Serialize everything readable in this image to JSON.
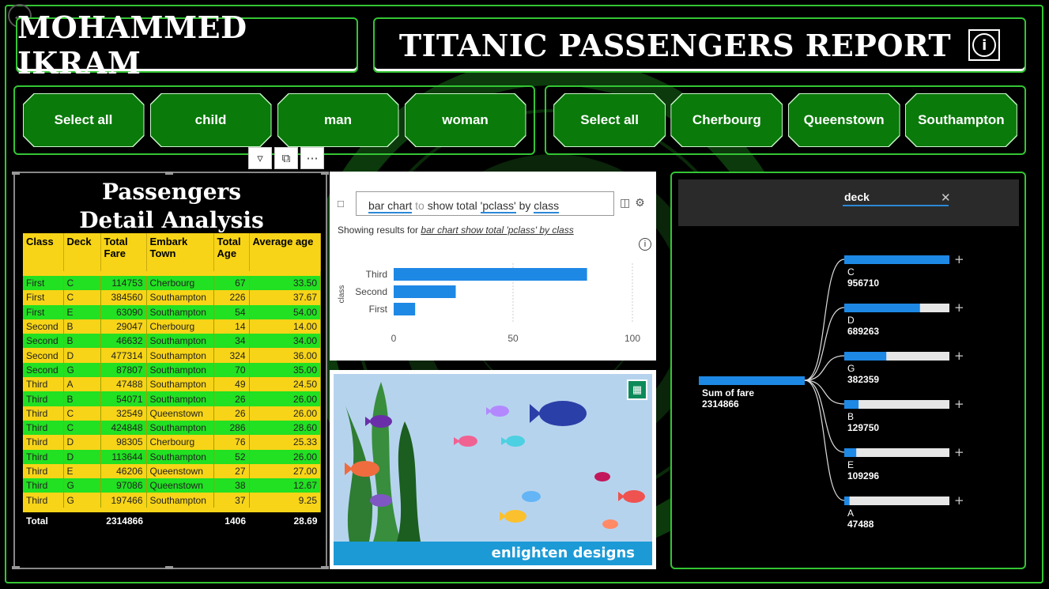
{
  "header": {
    "author": "MOHAMMED IKRAM",
    "report_title": "TITANIC PASSENGERS REPORT"
  },
  "who_slicer": [
    "Select all",
    "child",
    "man",
    "woman"
  ],
  "embark_slicer": [
    "Select all",
    "Cherbourg",
    "Queenstown",
    "Southampton"
  ],
  "colors": {
    "accent_green": "#34c534",
    "button_green": "#0a7a0a",
    "row_green": "#22e022",
    "row_yellow": "#f7d417",
    "bar_blue": "#1e88e5"
  },
  "detail_table": {
    "title": "Passengers Detail Analysis",
    "columns": [
      "Class",
      "Deck",
      "Total Fare",
      "Embark Town",
      "Total Age",
      "Average age"
    ],
    "rows": [
      [
        "First",
        "C",
        "114753",
        "Cherbourg",
        "67",
        "33.50"
      ],
      [
        "First",
        "C",
        "384560",
        "Southampton",
        "226",
        "37.67"
      ],
      [
        "First",
        "E",
        "63090",
        "Southampton",
        "54",
        "54.00"
      ],
      [
        "Second",
        "B",
        "29047",
        "Cherbourg",
        "14",
        "14.00"
      ],
      [
        "Second",
        "B",
        "46632",
        "Southampton",
        "34",
        "34.00"
      ],
      [
        "Second",
        "D",
        "477314",
        "Southampton",
        "324",
        "36.00"
      ],
      [
        "Second",
        "G",
        "87807",
        "Southampton",
        "70",
        "35.00"
      ],
      [
        "Third",
        "A",
        "47488",
        "Southampton",
        "49",
        "24.50"
      ],
      [
        "Third",
        "B",
        "54071",
        "Southampton",
        "26",
        "26.00"
      ],
      [
        "Third",
        "C",
        "32549",
        "Queenstown",
        "26",
        "26.00"
      ],
      [
        "Third",
        "C",
        "424848",
        "Southampton",
        "286",
        "28.60"
      ],
      [
        "Third",
        "D",
        "98305",
        "Cherbourg",
        "76",
        "25.33"
      ],
      [
        "Third",
        "D",
        "113644",
        "Southampton",
        "52",
        "26.00"
      ],
      [
        "Third",
        "E",
        "46206",
        "Queenstown",
        "27",
        "27.00"
      ],
      [
        "Third",
        "G",
        "97086",
        "Queenstown",
        "38",
        "12.67"
      ],
      [
        "Third",
        "G",
        "197466",
        "Southampton",
        "37",
        "9.25"
      ]
    ],
    "total": [
      "Total",
      "",
      "2314866",
      "",
      "1406",
      "28.69"
    ]
  },
  "qa": {
    "query_keyword1": "bar chart",
    "query_connector": " to ",
    "query_middle": "show total ",
    "query_keyword2": "'pclass'",
    "query_by": " by ",
    "query_keyword3": "class",
    "result_prefix": "Showing results for ",
    "result_link": "bar chart show total 'pclass' by class",
    "info": "i"
  },
  "chart_data": {
    "type": "bar",
    "orientation": "horizontal",
    "categories": [
      "Third",
      "Second",
      "First"
    ],
    "values": [
      81,
      26,
      9
    ],
    "ylabel": "class",
    "xlim": [
      0,
      100
    ],
    "xticks": [
      0,
      50,
      100
    ]
  },
  "fish_visual": {
    "brand": "enlighten designs"
  },
  "decomp_tree": {
    "search_value": "deck",
    "root_label": "Sum of fare",
    "root_value": "2314866",
    "nodes": [
      {
        "label": "C",
        "value": "956710",
        "fraction": 1.0
      },
      {
        "label": "D",
        "value": "689263",
        "fraction": 0.72
      },
      {
        "label": "G",
        "value": "382359",
        "fraction": 0.4
      },
      {
        "label": "B",
        "value": "129750",
        "fraction": 0.136
      },
      {
        "label": "E",
        "value": "109296",
        "fraction": 0.114
      },
      {
        "label": "A",
        "value": "47488",
        "fraction": 0.05
      }
    ]
  }
}
